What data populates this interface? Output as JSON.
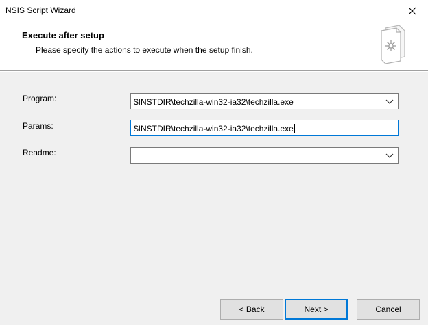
{
  "window": {
    "title": "NSIS Script Wizard",
    "close_icon": "close-icon"
  },
  "header": {
    "title": "Execute after setup",
    "subtitle": "Please specify the actions to execute when the setup finish.",
    "icon": "document-gear-icon"
  },
  "form": {
    "program": {
      "label": "Program:",
      "value": "$INSTDIR\\techzilla-win32-ia32\\techzilla.exe"
    },
    "params": {
      "label": "Params:",
      "value": "$INSTDIR\\techzilla-win32-ia32\\techzilla.exe"
    },
    "readme": {
      "label": "Readme:",
      "value": ""
    }
  },
  "buttons": {
    "back": "< Back",
    "next": "Next >",
    "cancel": "Cancel"
  }
}
